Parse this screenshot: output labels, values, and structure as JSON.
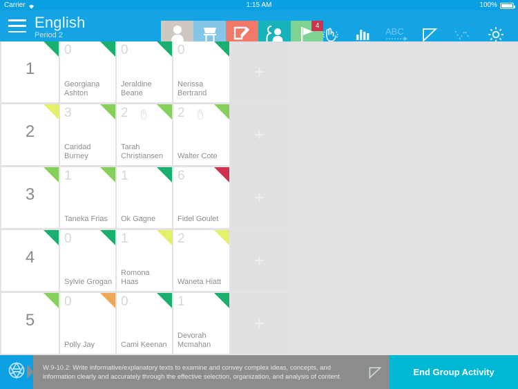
{
  "statusbar": {
    "carrier": "Carrier",
    "wifi_icon": "wifi-icon",
    "time": "1:15 AM",
    "battery_percent": "100%",
    "battery_icon": "battery-full-icon"
  },
  "navbar": {
    "menu_icon": "hamburger-menu-icon",
    "title": "English",
    "subtitle": "Period 2",
    "tools": [
      {
        "name": "student-tool",
        "icon": "person-icon",
        "color": "#cfc8c0",
        "badge": null
      },
      {
        "name": "seating-tool",
        "icon": "chair-icon",
        "color": "#85c6e8",
        "badge": null
      },
      {
        "name": "notes-tool",
        "icon": "pencil-note-icon",
        "color": "#f0796a",
        "badge": null
      },
      {
        "name": "groups-tool",
        "icon": "two-people-icon",
        "color": "#18b2bb",
        "badge": null
      },
      {
        "name": "activity-tool",
        "icon": "flag-icon",
        "color": "#7ed392",
        "badge": "4"
      }
    ],
    "plain_tools": [
      {
        "name": "raise-hand-tool",
        "icon": "hand-tap-icon",
        "dim": false
      },
      {
        "name": "chart-tool",
        "icon": "bar-chart-icon",
        "dim": false
      },
      {
        "name": "vocabulary-tool",
        "icon": "abc-arrow-icon",
        "dim": true
      },
      {
        "name": "flag-tool",
        "icon": "pennant-icon",
        "dim": false
      },
      {
        "name": "graph-tool",
        "icon": "zigzag-icon",
        "dim": true
      },
      {
        "name": "settings-tool",
        "icon": "gear-icon",
        "dim": false
      }
    ]
  },
  "grid": {
    "add_placeholder": "+",
    "rows": [
      {
        "group": "1",
        "group_corner": "#19b06d",
        "students": [
          {
            "score": "0",
            "name": "Georgiana Ashton",
            "corner": "#19b06d",
            "hand": false
          },
          {
            "score": "0",
            "name": "Jeraldine Beane",
            "corner": "#19b06d",
            "hand": false
          },
          {
            "score": "0",
            "name": "Nerissa Bertrand",
            "corner": "#19b06d",
            "hand": false
          }
        ]
      },
      {
        "group": "2",
        "group_corner": "#e4f06a",
        "students": [
          {
            "score": "3",
            "name": "Caridad Burney",
            "corner": "#86cf5a",
            "hand": false
          },
          {
            "score": "2",
            "name": "Tarah Christiansen",
            "corner": "#86cf5a",
            "hand": true
          },
          {
            "score": "2",
            "name": "Walter Cote",
            "corner": "#86cf5a",
            "hand": true
          }
        ]
      },
      {
        "group": "3",
        "group_corner": "#86cf5a",
        "students": [
          {
            "score": "1",
            "name": "Taneka Frias",
            "corner": "#86cf5a",
            "hand": false
          },
          {
            "score": "1",
            "name": "Ok Gagne",
            "corner": "#efa martínez",
            "hand": false
          },
          {
            "score": "6",
            "name": "Fidel Goulet",
            "corner": "#d0314c",
            "hand": false
          }
        ]
      },
      {
        "group": "4",
        "group_corner": "#19b06d",
        "students": [
          {
            "score": "0",
            "name": "Sylvie Grogan",
            "corner": "#19b06d",
            "hand": false
          },
          {
            "score": "1",
            "name": "Romona Haas",
            "corner": "#e4f06a",
            "hand": false
          },
          {
            "score": "2",
            "name": "Waneta Hiatt",
            "corner": "#e4f06a",
            "hand": false
          }
        ]
      },
      {
        "group": "5",
        "group_corner": "#86cf5a",
        "students": [
          {
            "score": "0",
            "name": "Polly Jay",
            "corner": "#efa85a",
            "hand": false
          },
          {
            "score": "0",
            "name": "Cami Keenan",
            "corner": "#19b06d",
            "hand": false
          },
          {
            "score": "1",
            "name": "Devorah Mcmahan",
            "corner": "#19b06d",
            "hand": false
          }
        ]
      }
    ]
  },
  "bottombar": {
    "camera_icon": "aperture-camera-icon",
    "standard_text": "W.9-10.2: Write informative/explanatory texts to examine and convey complex ideas, concepts, and information clearly and accurately through the effective selection, organization, and analysis of content.",
    "flag_icon": "pennant-icon",
    "end_label": "End Group Activity"
  }
}
